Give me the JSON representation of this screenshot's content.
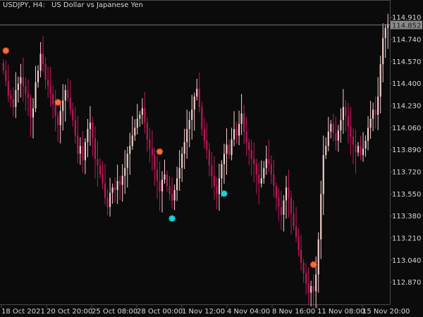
{
  "header": {
    "symbol_timeframe": "USDJPY, H4:",
    "description": "US Dollar vs Japanese Yen"
  },
  "colors": {
    "background": "#0b0b0b",
    "frame": "#4a4a4a",
    "text": "#d8d8d8",
    "candle_up": "#f7d0cf",
    "candle_down": "#c2185b",
    "price_line": "#777777",
    "price_label_bg": "#8a8a8a",
    "price_label_text": "#1a1a1a",
    "sell_marker": "#ff6a3d",
    "buy_marker": "#19d3da"
  },
  "chart_data": {
    "type": "candlestick",
    "symbol": "USDJPY",
    "timeframe": "H4",
    "ylim": [
      112.7,
      114.99
    ],
    "y_ticks": [
      114.91,
      114.74,
      114.57,
      114.4,
      114.23,
      114.06,
      113.89,
      113.72,
      113.55,
      113.38,
      113.21,
      113.04,
      112.87
    ],
    "x_ticks": [
      "18 Oct 2021",
      "20 Oct 20:00",
      "25 Oct 08:00",
      "28 Oct 00:00",
      "1 Nov 12:00",
      "4 Nov 04:00",
      "8 Nov 16:00",
      "11 Nov 08:00",
      "15 Nov 20:00"
    ],
    "current_price": 114.852,
    "current_price_label": "114.852",
    "closes": [
      114.5,
      114.42,
      114.31,
      114.28,
      114.22,
      114.35,
      114.4,
      114.45,
      114.38,
      114.32,
      114.29,
      114.14,
      114.21,
      114.41,
      114.5,
      114.63,
      114.55,
      114.43,
      114.38,
      114.32,
      114.24,
      114.15,
      114.08,
      114.19,
      114.27,
      114.35,
      114.29,
      114.2,
      114.12,
      114.0,
      113.86,
      113.92,
      113.81,
      113.95,
      114.05,
      114.1,
      113.98,
      113.82,
      113.77,
      113.7,
      113.63,
      113.52,
      113.45,
      113.56,
      113.6,
      113.58,
      113.65,
      113.62,
      113.69,
      113.75,
      113.86,
      113.92,
      114.0,
      114.06,
      114.13,
      114.16,
      114.21,
      114.1,
      113.97,
      113.9,
      113.85,
      113.74,
      113.65,
      113.57,
      113.66,
      113.7,
      113.61,
      113.55,
      113.5,
      113.58,
      113.67,
      113.75,
      113.86,
      113.95,
      114.05,
      114.12,
      114.2,
      114.3,
      114.36,
      114.22,
      114.05,
      113.96,
      113.89,
      113.77,
      113.69,
      113.61,
      113.55,
      113.67,
      113.78,
      113.86,
      113.93,
      113.85,
      113.97,
      114.05,
      114.0,
      114.09,
      114.17,
      114.03,
      113.95,
      113.89,
      113.82,
      113.78,
      113.7,
      113.63,
      113.67,
      113.75,
      113.82,
      113.78,
      113.7,
      113.61,
      113.52,
      113.45,
      113.39,
      113.5,
      113.6,
      113.52,
      113.4,
      113.3,
      113.22,
      113.12,
      113.02,
      112.94,
      112.86,
      112.79,
      112.84,
      112.8,
      112.93,
      113.2,
      113.55,
      113.85,
      113.92,
      114.03,
      114.09,
      114.02,
      113.96,
      114.04,
      114.12,
      114.22,
      114.15,
      114.07,
      113.99,
      113.93,
      113.87,
      113.92,
      113.85,
      113.9,
      113.96,
      114.06,
      114.13,
      114.2,
      114.16,
      114.3,
      114.55,
      114.75,
      114.83,
      114.86
    ]
  },
  "markers": {
    "sell_indices": [
      1,
      22,
      63,
      125
    ],
    "buy_indices": [
      68,
      89
    ]
  },
  "legend": []
}
